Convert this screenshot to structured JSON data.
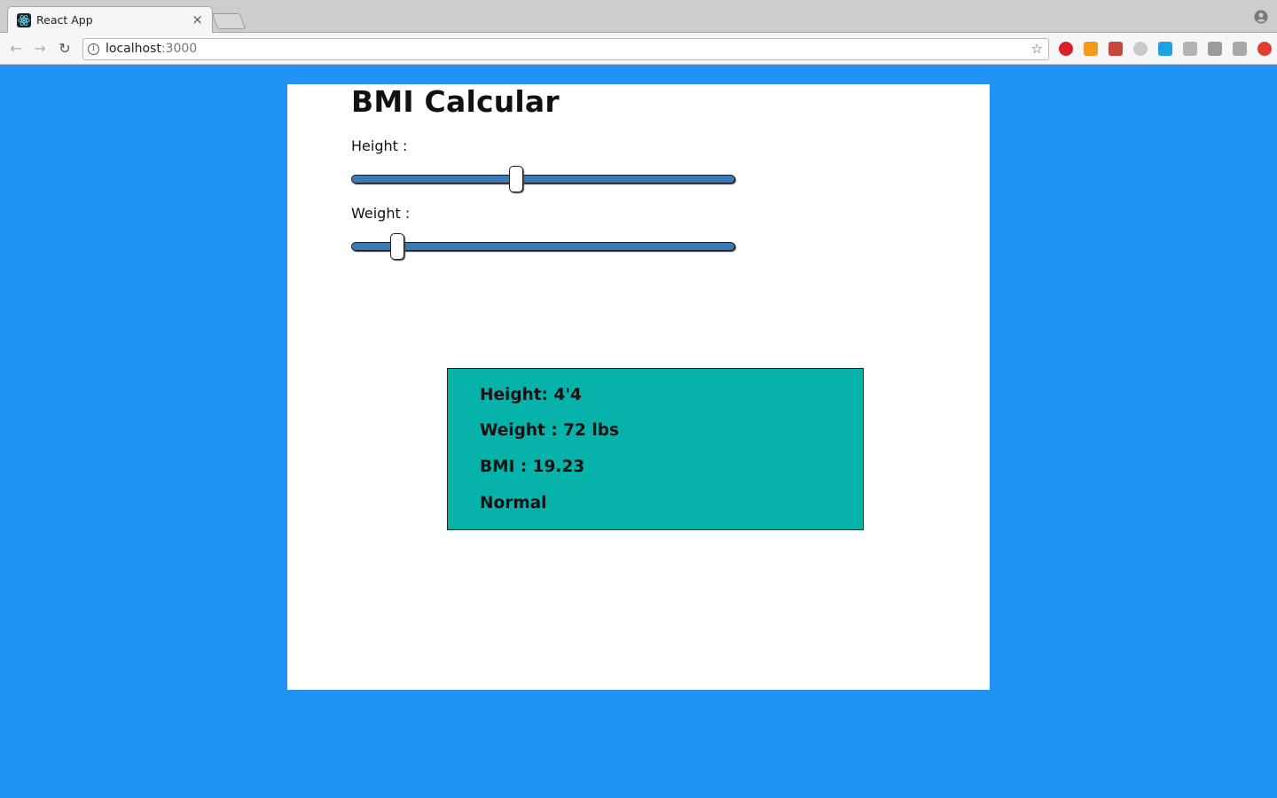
{
  "browser": {
    "tab_title": "React App",
    "tab_close": "×",
    "url_host": "localhost",
    "url_port": ":3000",
    "extensions": [
      {
        "name": "adblock-plus",
        "color": "#d8212b"
      },
      {
        "name": "orange-extension",
        "color": "#f39a1c"
      },
      {
        "name": "red-extension",
        "color": "#c9463d"
      },
      {
        "name": "gray-circle-extension",
        "color": "#c9c9c9"
      },
      {
        "name": "blue-window-extension",
        "color": "#1ca3e2"
      },
      {
        "name": "gray-envelope-extension",
        "color": "#b3b3b3"
      },
      {
        "name": "refresh-extension",
        "color": "#9b9b9b"
      },
      {
        "name": "g-extension",
        "color": "#a8a8a8"
      },
      {
        "name": "red-upload-extension",
        "color": "#e23b2f"
      }
    ]
  },
  "app": {
    "title": "BMI Calcular",
    "height_label": "Height :",
    "weight_label": "Weight :",
    "height_slider_fraction": 0.43,
    "weight_slider_fraction": 0.12,
    "background_color": "#2192f6",
    "result_color": "#06b3aa"
  },
  "result": {
    "height": "Height: 4'4",
    "weight": "Weight : 72 lbs",
    "bmi": "BMI : 19.23",
    "category": "Normal"
  }
}
